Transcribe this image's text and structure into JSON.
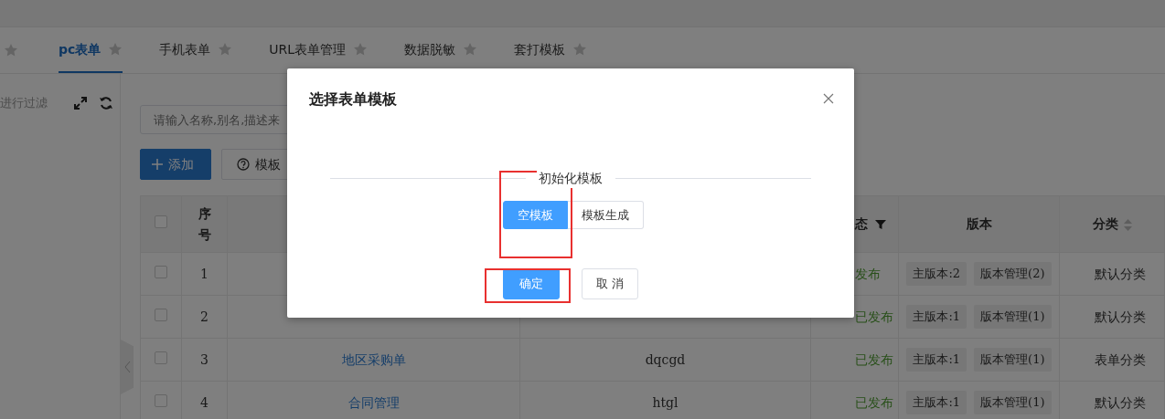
{
  "tabs": [
    {
      "label": "pc表单",
      "selected": true
    },
    {
      "label": "手机表单",
      "selected": false
    },
    {
      "label": "URL表单管理",
      "selected": false
    },
    {
      "label": "数据脱敏",
      "selected": false
    },
    {
      "label": "套打模板",
      "selected": false
    }
  ],
  "sidebar": {
    "filter_hint": "进行过滤"
  },
  "search": {
    "placeholder": "请输入名称,别名,描述来"
  },
  "toolbar_buttons": [
    {
      "label": "添加",
      "kind": "primary"
    },
    {
      "label": "模板",
      "kind": "help"
    }
  ],
  "table": {
    "select_all_checked": false,
    "columns": [
      {
        "label": "序号"
      },
      {},
      {},
      {
        "label": "态",
        "filter": true
      },
      {
        "label": "版本"
      },
      {
        "label": "分类",
        "sortable": true
      }
    ],
    "rows": [
      {
        "index": "1",
        "status": "发布",
        "main_version": "主版本:2",
        "version_manage": "版本管理(2)",
        "category": "默认分类",
        "checked": false
      },
      {
        "index": "2",
        "status": "已发布",
        "main_version": "主版本:1",
        "version_manage": "版本管理(1)",
        "category": "默认分类",
        "checked": false
      },
      {
        "index": "3",
        "name": "地区采购单",
        "code": "dqcgd",
        "status": "已发布",
        "main_version": "主版本:1",
        "version_manage": "版本管理(1)",
        "category": "表单分类",
        "checked": false
      },
      {
        "index": "4",
        "name": "合同管理",
        "code": "htgl",
        "status": "已发布",
        "main_version": "主版本:1",
        "version_manage": "版本管理(1)",
        "category": "默认分类",
        "checked": false
      }
    ]
  },
  "dialog": {
    "title": "选择表单模板",
    "section_label": "初始化模板",
    "options": [
      {
        "label": "空模板",
        "selected": true
      },
      {
        "label": "模板生成",
        "selected": false
      }
    ],
    "buttons": [
      {
        "label": "确定",
        "kind": "primary"
      },
      {
        "label": "取 消",
        "kind": "default"
      }
    ]
  }
}
